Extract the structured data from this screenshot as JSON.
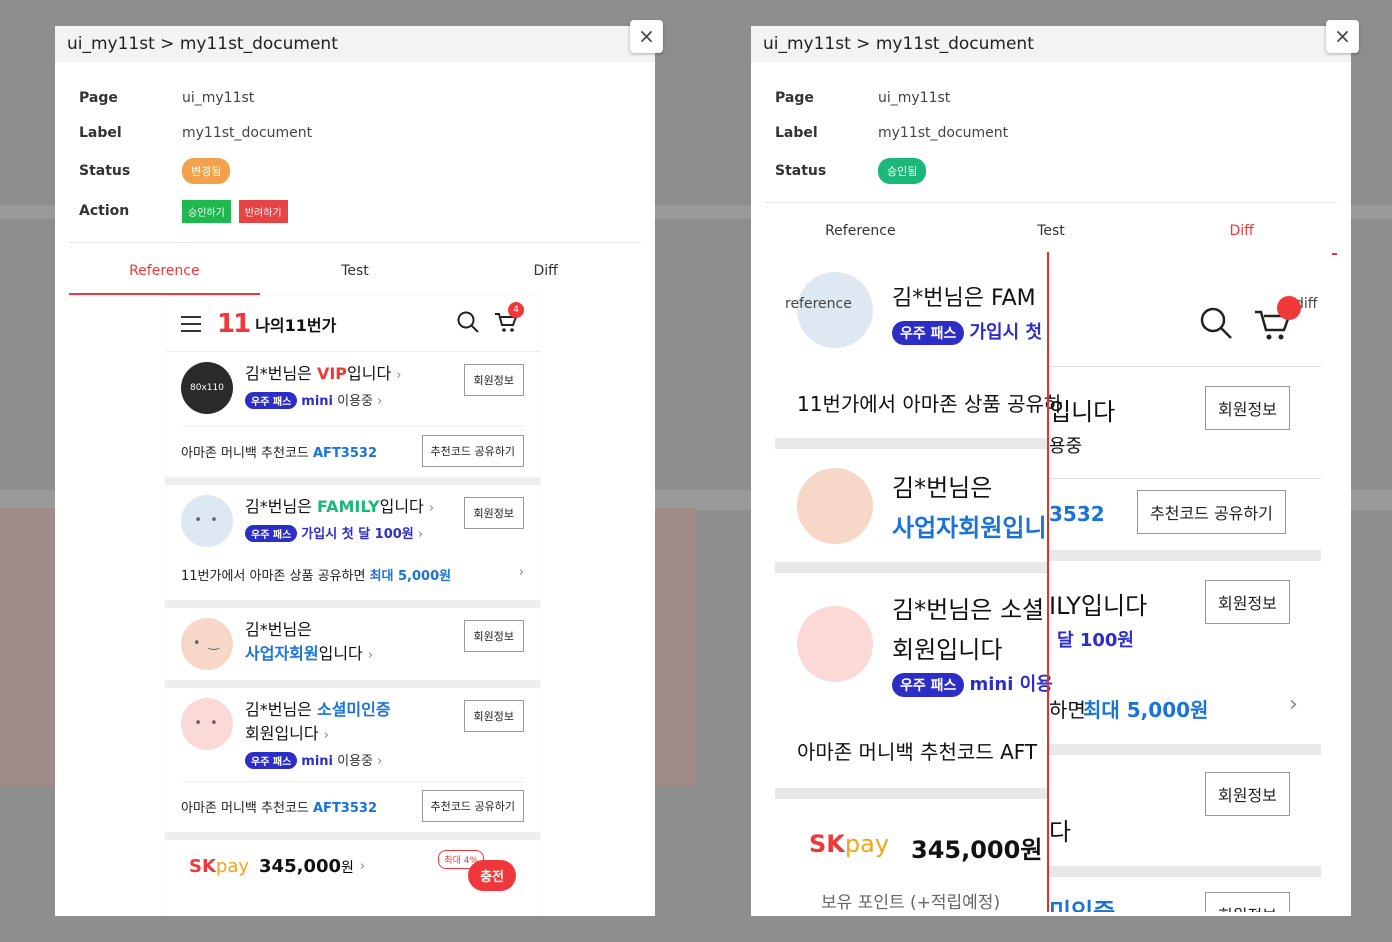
{
  "left": {
    "header": "ui_my11st > my11st_document",
    "page_key": "Page",
    "page_val": "ui_my11st",
    "label_key": "Label",
    "label_val": "my11st_document",
    "status_key": "Status",
    "status_val": "변경됨",
    "action_key": "Action",
    "approve": "승인하기",
    "reject": "반려하기",
    "tabs": [
      "Reference",
      "Test",
      "Diff"
    ]
  },
  "right": {
    "header": "ui_my11st > my11st_document",
    "page_key": "Page",
    "page_val": "ui_my11st",
    "label_key": "Label",
    "label_val": "my11st_document",
    "status_key": "Status",
    "status_val": "승인됨",
    "tabs": [
      "Reference",
      "Test",
      "Diff"
    ]
  },
  "close": "×",
  "mobile": {
    "logo": "11",
    "title": "나의11번가",
    "cart_count": "4",
    "cards": [
      {
        "avatar_text": "80x110",
        "name_pre": "김*번님은 ",
        "name_hl": "VIP",
        "name_post": "입니다",
        "pass": "우주 패스",
        "sub_hl": "mini",
        "sub_post": " 이용중",
        "btn": "회원정보"
      },
      {
        "name_pre": "김*번님은 ",
        "name_hl": "FAMILY",
        "name_post": "입니다",
        "pass": "우주 패스",
        "sub_hl": "가입시 첫 달 100원",
        "btn": "회원정보"
      },
      {
        "name_pre": "김*번님은",
        "name_hl": "사업자회원",
        "name_post": "입니다",
        "btn": "회원정보"
      },
      {
        "name_pre": "김*번님은 ",
        "name_hl": "소셜미인증",
        "name_post2": "회원입니다",
        "pass": "우주 패스",
        "sub_hl": "mini",
        "sub_post": " 이용중",
        "btn": "회원정보"
      }
    ],
    "code_label": "아마존 머니백 추천코드 ",
    "code_value": "AFT3532",
    "code_btn": "추천코드 공유하기",
    "share_pre": "11번가에서 아마존 상품 공유하면 ",
    "share_hl": "최대 5,000원",
    "pay_brand": "SK",
    "pay_brand2": "pay",
    "pay_amount": "345,000",
    "pay_unit": "원",
    "pay_max": "최대 4%",
    "pay_charge": "충전"
  },
  "diff": {
    "label_ref": "reference",
    "label_diff": "diff",
    "fam": "김*번님은 FAM",
    "join": "가입시 첫",
    "share_left": "11번가에서 아마존 상품 공유하",
    "share_right": "입니다",
    "mini_frag": "용중",
    "biz1": "김*번님은",
    "biz2": "사업자회원입니",
    "code_frag": "3532",
    "code_btn": "추천코드 공유하기",
    "social1": "김*번님은 소셜",
    "social2": "회원입니다",
    "mini": "mini 이용",
    "ily": "ILY입니다",
    "month": "달 100원",
    "myeon": "하면 ",
    "max": "최대 5,000원",
    "amazon": "아마존 머니백 추천코드 AFT",
    "da": "다",
    "pay": "345,000원",
    "point": "보유 포인트 (+적립예정)",
    "mi": "미인증",
    "btn": "회원정보"
  }
}
